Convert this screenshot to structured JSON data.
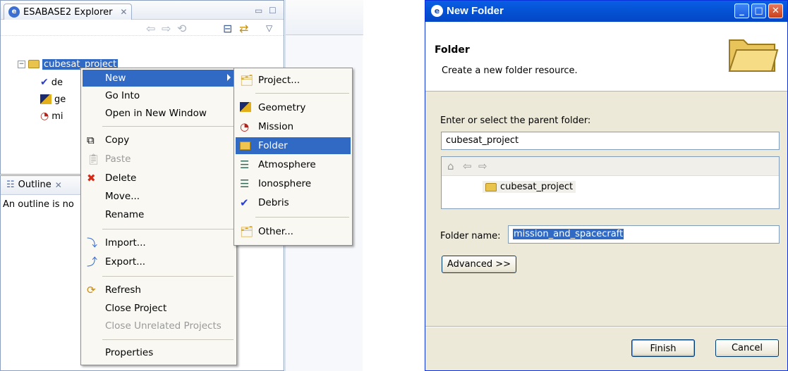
{
  "explorer": {
    "tab_title": "ESABASE2 Explorer",
    "tab_close": "✕",
    "icons": [
      "back-arrow-icon",
      "forward-arrow-icon",
      "up-icon",
      "collapse-all-icon",
      "link-editor-icon",
      "view-menu-icon"
    ],
    "tree": {
      "project": "cubesat_project",
      "children": [
        "de",
        "ge",
        "mi"
      ]
    }
  },
  "outline": {
    "tab_title": "Outline",
    "tab_close": "✕",
    "message": "An outline is no"
  },
  "context_menu": {
    "items": [
      {
        "label": "New",
        "highlighted": true,
        "submenu": true
      },
      {
        "label": "Go Into"
      },
      {
        "label": "Open in New Window"
      },
      {
        "separator": true
      },
      {
        "label": "Copy",
        "icon": "copy-icon"
      },
      {
        "label": "Paste",
        "icon": "paste-icon",
        "disabled": true
      },
      {
        "label": "Delete",
        "icon": "delete-icon"
      },
      {
        "label": "Move..."
      },
      {
        "label": "Rename"
      },
      {
        "separator": true
      },
      {
        "label": "Import...",
        "icon": "import-icon"
      },
      {
        "label": "Export...",
        "icon": "export-icon"
      },
      {
        "separator": true
      },
      {
        "label": "Refresh",
        "icon": "refresh-icon"
      },
      {
        "label": "Close Project"
      },
      {
        "label": "Close Unrelated Projects",
        "disabled": true
      },
      {
        "separator": true
      },
      {
        "label": "Properties"
      }
    ]
  },
  "submenu": {
    "items": [
      {
        "label": "Project...",
        "icon": "new-project-icon"
      },
      {
        "separator": true
      },
      {
        "label": "Geometry",
        "icon": "geometry-icon"
      },
      {
        "label": "Mission",
        "icon": "mission-icon"
      },
      {
        "label": "Folder",
        "icon": "new-folder-icon",
        "highlighted": true
      },
      {
        "label": "Atmosphere",
        "icon": "atmosphere-icon"
      },
      {
        "label": "Ionosphere",
        "icon": "ionosphere-icon"
      },
      {
        "label": "Debris",
        "icon": "debris-icon"
      },
      {
        "separator": true
      },
      {
        "label": "Other...",
        "icon": "other-icon"
      }
    ]
  },
  "dialog": {
    "title": "New Folder",
    "heading": "Folder",
    "description": "Create a new folder resource.",
    "parent_label": "Enter or select the parent folder:",
    "parent_value": "cubesat_project",
    "tree_item": "cubesat_project",
    "folder_name_label": "Folder name:",
    "folder_name_value": "mission_and_spacecraft",
    "advanced_button": "Advanced >>",
    "finish_button": "Finish",
    "cancel_button": "Cancel",
    "colors": {
      "titlebar": "#0554d6",
      "selection": "#316ac5",
      "face": "#ece9d8"
    }
  }
}
